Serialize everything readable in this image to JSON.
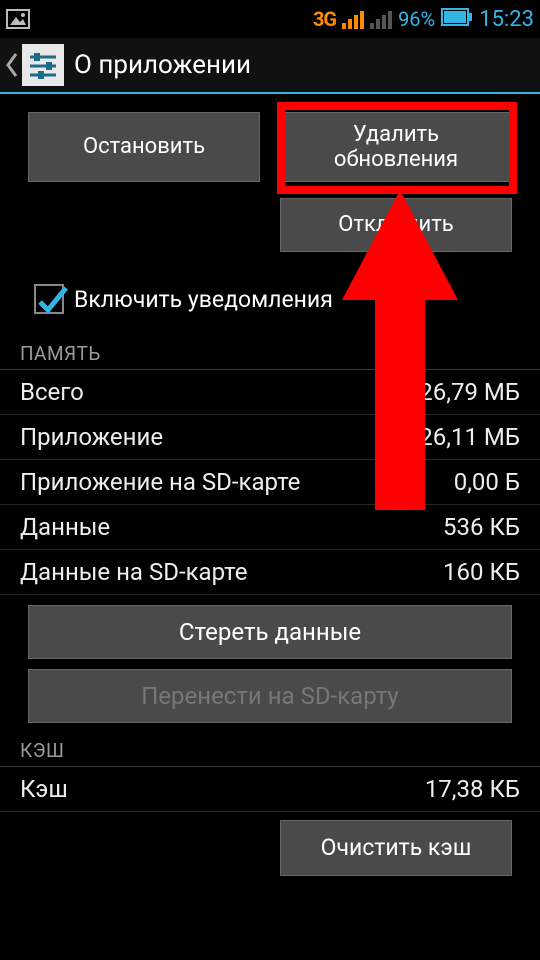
{
  "status": {
    "network_label": "3G",
    "battery_pct": "96%",
    "time": "15:23"
  },
  "action_bar": {
    "title": "О приложении"
  },
  "buttons": {
    "stop": "Остановить",
    "delete_updates": "Удалить\nобновления",
    "disable": "Отключить",
    "clear_data": "Стереть данные",
    "move_to_sd": "Перенести на SD-карту",
    "clear_cache": "Очистить кэш"
  },
  "checkbox": {
    "notifications_label": "Включить уведомления",
    "checked": true
  },
  "sections": {
    "storage": "ПАМЯТЬ",
    "cache": "КЭШ"
  },
  "storage": {
    "total_label": "Всего",
    "total_value": "26,79 МБ",
    "app_label": "Приложение",
    "app_value": "26,11 МБ",
    "app_sd_label": "Приложение на SD-карте",
    "app_sd_value": "0,00 Б",
    "data_label": "Данные",
    "data_value": "536 КБ",
    "data_sd_label": "Данные на SD-карте",
    "data_sd_value": "160 КБ"
  },
  "cache": {
    "cache_label": "Кэш",
    "cache_value": "17,38 КБ"
  },
  "colors": {
    "holo_blue": "#33b5e5",
    "annotation_red": "#ff0000",
    "orange": "#ff8a00"
  }
}
